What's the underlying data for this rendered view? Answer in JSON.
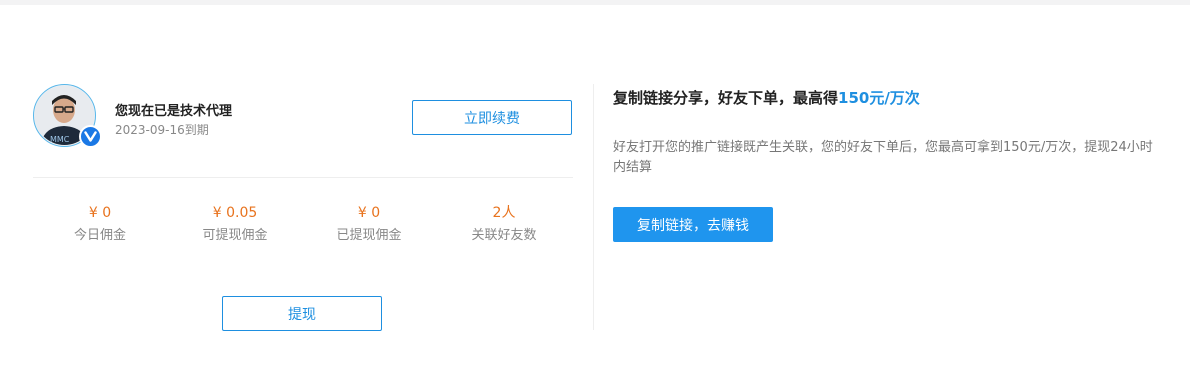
{
  "account": {
    "status": "您现在已是技术代理",
    "expiry": "2023-09-16到期",
    "renew_label": "立即续费",
    "badge_icon": "vip-check-icon"
  },
  "stats": [
    {
      "value": "¥ 0",
      "label": "今日佣金"
    },
    {
      "value": "¥ 0.05",
      "label": "可提现佣金"
    },
    {
      "value": "¥ 0",
      "label": "已提现佣金"
    },
    {
      "value": "2人",
      "label": "关联好友数"
    }
  ],
  "withdraw_label": "提现",
  "promo": {
    "headline_prefix": "复制链接分享，好友下单，最高得",
    "headline_highlight": "150元/万次",
    "description": "好友打开您的推广链接既产生关联，您的好友下单后，您最高可拿到150元/万次，提现24小时内结算",
    "copy_button_label": "复制链接，去赚钱"
  },
  "colors": {
    "accent": "#1e8fe0",
    "money": "#e8731e",
    "primary_button": "#1f95ee"
  }
}
